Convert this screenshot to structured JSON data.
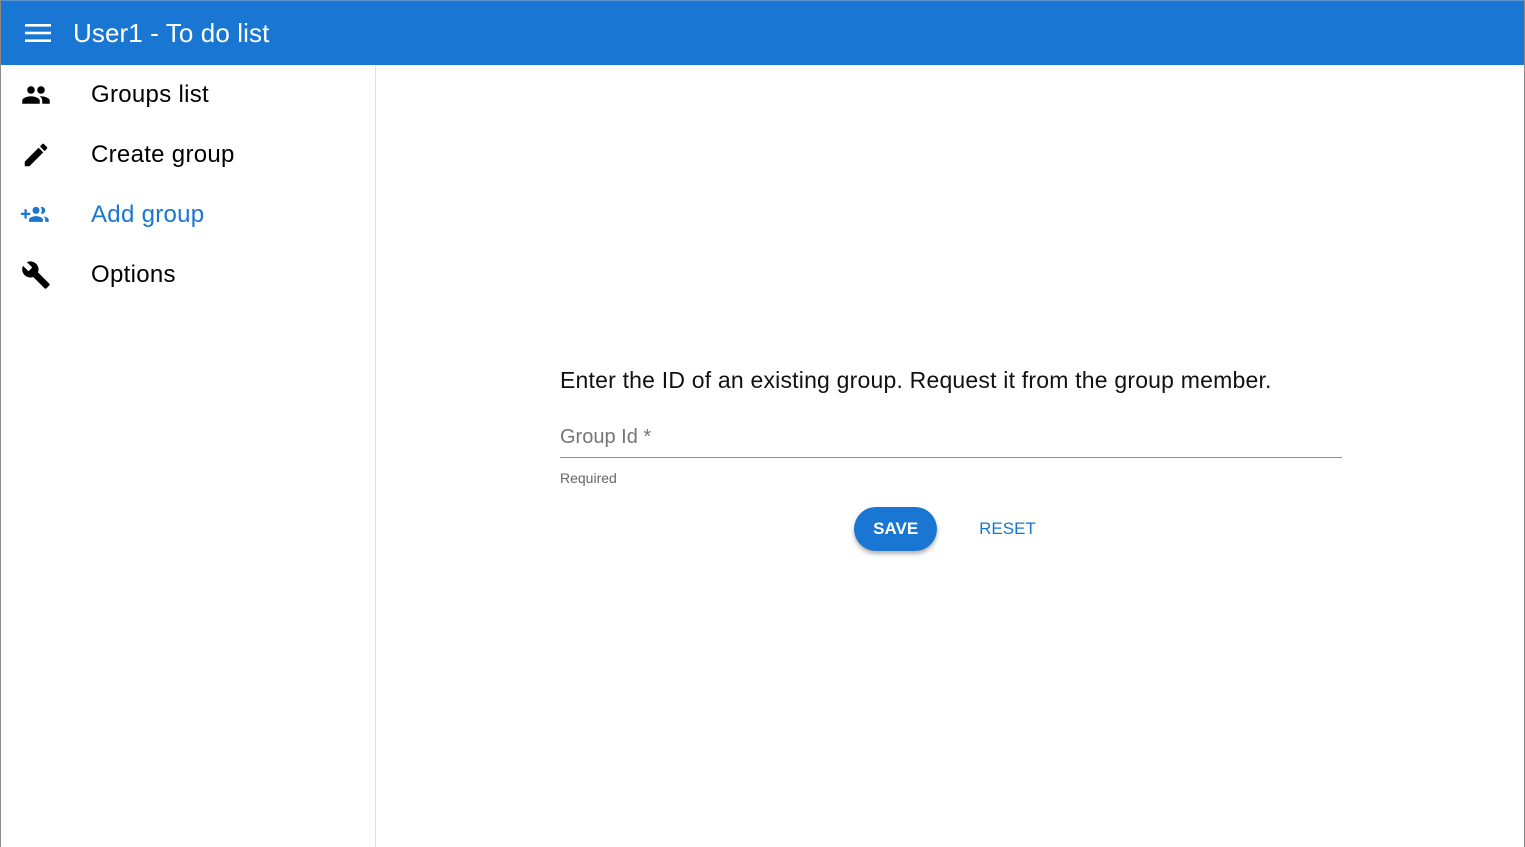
{
  "app": {
    "title": "User1 - To do list",
    "accent_color": "#1976d2"
  },
  "sidebar": {
    "items": [
      {
        "label": "Groups list",
        "icon": "people-icon",
        "active": false
      },
      {
        "label": "Create group",
        "icon": "pencil-icon",
        "active": false
      },
      {
        "label": "Add group",
        "icon": "group-add-icon",
        "active": true
      },
      {
        "label": "Options",
        "icon": "wrench-icon",
        "active": false
      }
    ]
  },
  "form": {
    "prompt": "Enter the ID of an existing group. Request it from the group member.",
    "group_id": {
      "placeholder": "Group Id *",
      "value": "",
      "helper": "Required"
    },
    "save_label": "SAVE",
    "reset_label": "RESET"
  }
}
